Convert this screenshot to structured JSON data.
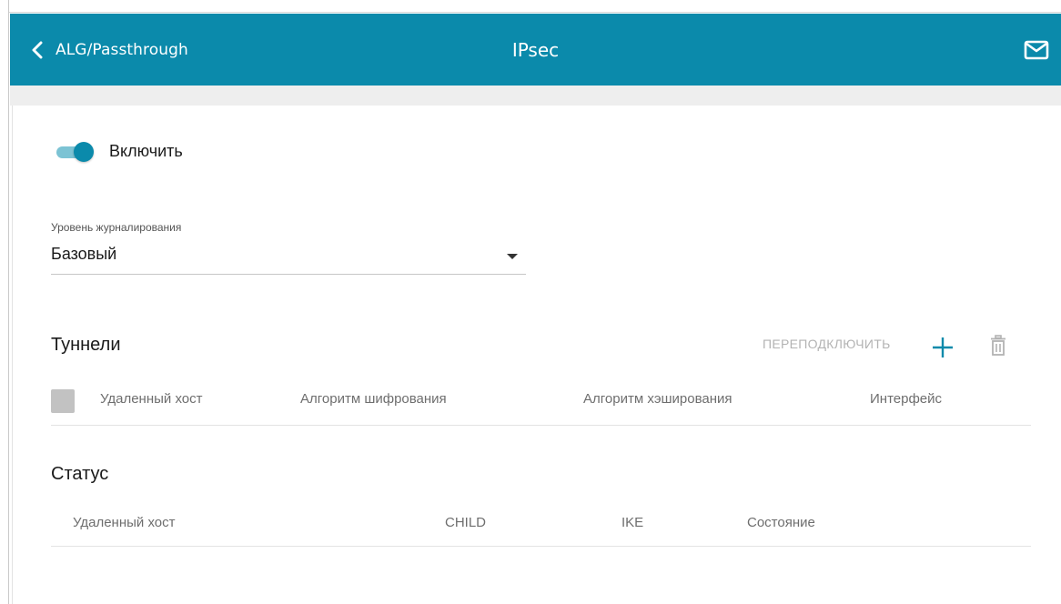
{
  "header": {
    "back_label": "ALG/Passthrough",
    "title": "IPsec",
    "icons": {
      "back": "chevron-left-icon",
      "mail": "mail-icon"
    }
  },
  "colors": {
    "header_bg": "#0b8aab",
    "toggle_on": "#0b8aab",
    "toggle_track": "#7cc3d4",
    "muted_action": "#b3b3b3"
  },
  "enable": {
    "label": "Включить",
    "checked": true
  },
  "log_level": {
    "label": "Уровень журналирования",
    "value": "Базовый"
  },
  "tunnels": {
    "title": "Туннели",
    "reconnect_label": "ПЕРЕПОДКЛЮЧИТЬ",
    "icons": {
      "add": "plus-icon",
      "delete": "trash-icon"
    },
    "columns": [
      "Удаленный хост",
      "Алгоритм шифрования",
      "Алгоритм хэширования",
      "Интерфейс"
    ],
    "rows": []
  },
  "status": {
    "title": "Статус",
    "columns": [
      "Удаленный хост",
      "CHILD",
      "IKE",
      "Состояние"
    ],
    "rows": []
  }
}
